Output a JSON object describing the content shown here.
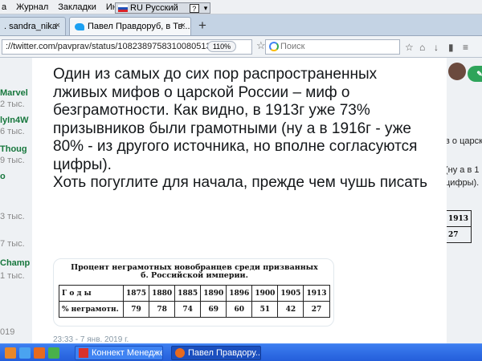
{
  "menubar": {
    "items": [
      "а",
      "Журнал",
      "Закладки",
      "Инстру"
    ]
  },
  "language_bar": {
    "label": "RU Русский",
    "help": "?"
  },
  "tabs": [
    {
      "label": ". sandra_nika",
      "close": "×"
    },
    {
      "label": "Павел Правдоруб, в Тв...",
      "close": "×"
    }
  ],
  "new_tab": "+",
  "navbar": {
    "url": "://twitter.com/pavprav/status/1082389758310080513",
    "zoom": "110%",
    "search_placeholder": "Поиск"
  },
  "left_column": [
    {
      "text": "Marvel",
      "style": "g"
    },
    {
      "text": "2 тыс.",
      "style": "s"
    },
    {
      "text": "lyIn4W",
      "style": "g"
    },
    {
      "text": "6 тыс.",
      "style": "s"
    },
    {
      "text": "Thoug",
      "style": "g"
    },
    {
      "text": "9 тыс.",
      "style": "s"
    },
    {
      "text": "o",
      "style": "g"
    },
    {
      "text": "3 тыс.",
      "style": "s"
    },
    {
      "text": "7 тыс.",
      "style": "s"
    },
    {
      "text": "Champ",
      "style": "g"
    },
    {
      "text": "1 тыс.",
      "style": "s"
    },
    {
      "text": "019",
      "style": "s"
    }
  ],
  "tweet": {
    "text": "Один из самых до сих пор распространенных лживых мифов о царской России – миф о безграмотности. Как видно, в 1913г уже 73% призывников были грамотными (ну а в 1916г - уже 80% - из другого источника, но вполне согласуются цифры).\nХоть погуглите для начала, прежде чем чушь писать",
    "timestamp": "23:33 - 7 янв. 2019 г."
  },
  "table_image": {
    "title": "Процент неграмотных новобранцев среди призванных\nб. Российской империи.",
    "row_years_label": "Г о д ы",
    "years": [
      "1875",
      "1880",
      "1885",
      "1890",
      "1896",
      "1900",
      "1905",
      "1913"
    ],
    "row_pct_label": "% неграмотн.",
    "percents": [
      "79",
      "78",
      "74",
      "69",
      "60",
      "51",
      "42",
      "27"
    ]
  },
  "right_column": {
    "lines": [
      "в о царск",
      "(ну а в 1",
      "цифры)."
    ],
    "mini_table": [
      "1913",
      "27"
    ]
  },
  "taskbar": {
    "tasks": [
      "Коннект Менеджер",
      "Павел Правдору..."
    ]
  },
  "colors": {
    "twitter_blue": "#1da1f2",
    "taskbar_blue": "#245edb",
    "green_username": "#17773d"
  }
}
